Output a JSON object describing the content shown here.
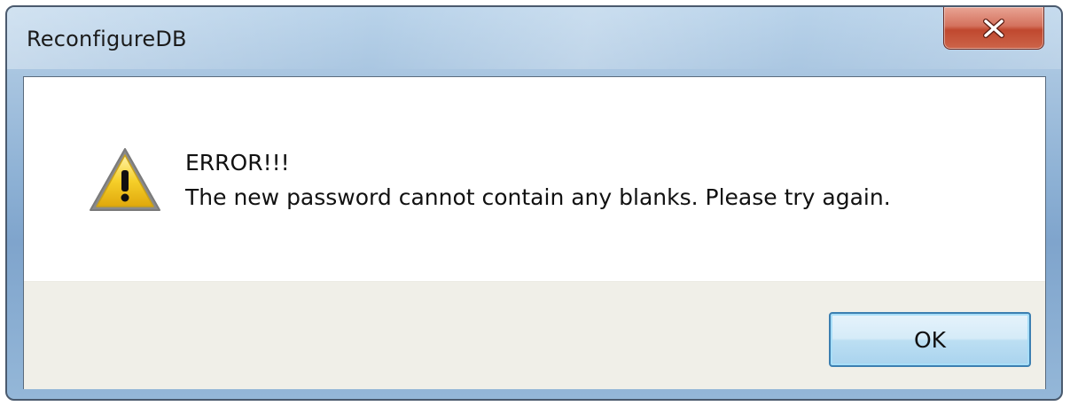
{
  "window": {
    "title": "ReconfigureDB"
  },
  "message": {
    "heading": "ERROR!!!",
    "body": "The new password cannot contain any blanks. Please try again."
  },
  "buttons": {
    "ok_label": "OK"
  },
  "icons": {
    "warning": "warning-icon",
    "close": "close-icon"
  },
  "colors": {
    "close_button": "#c7503a",
    "ok_border": "#3c7fb1",
    "footer_bg": "#f0efe8",
    "warning_fill": "#f4c91f"
  }
}
